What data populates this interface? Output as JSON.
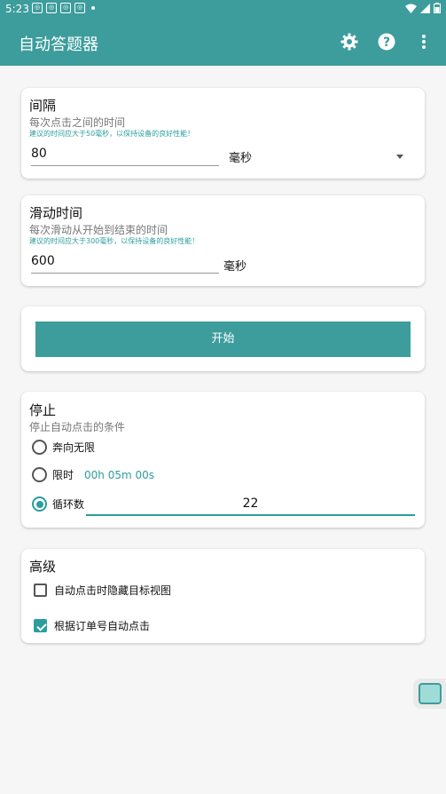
{
  "status_bar": {
    "time": "5:23",
    "notif_icons": [
      "app-icon",
      "app-icon",
      "app-icon",
      "app-icon"
    ]
  },
  "app_bar": {
    "title": "自动答题器",
    "actions": [
      "gear-icon",
      "help-icon",
      "more-vert-icon"
    ]
  },
  "interval": {
    "title": "间隔",
    "subtitle": "每次点击之间的时间",
    "hint": "建议的时间应大于50毫秒，以保持设备的良好性能！",
    "value": "80",
    "unit": "毫秒"
  },
  "swipe": {
    "title": "滑动时间",
    "subtitle": "每次滑动从开始到结束的时间",
    "hint": "建议的时间应大于300毫秒，以保持设备的良好性能！",
    "value": "600",
    "unit": "毫秒"
  },
  "start": {
    "label": "开始"
  },
  "stop": {
    "title": "停止",
    "subtitle": "停止自动点击的条件",
    "options": [
      {
        "label": "奔向无限",
        "selected": false
      },
      {
        "label": "限时",
        "extra": "00h 05m 00s",
        "selected": false
      },
      {
        "label": "循环数",
        "selected": true
      }
    ],
    "loop_count": "22"
  },
  "advanced": {
    "title": "高级",
    "options": [
      {
        "label": "自动点击时隐藏目标视图",
        "checked": false
      },
      {
        "label": "根据订单号自动点击",
        "checked": true
      }
    ]
  },
  "colors": {
    "primary": "#3d9c9c",
    "accent": "#2c9d9d",
    "background": "#f6f6f6"
  }
}
